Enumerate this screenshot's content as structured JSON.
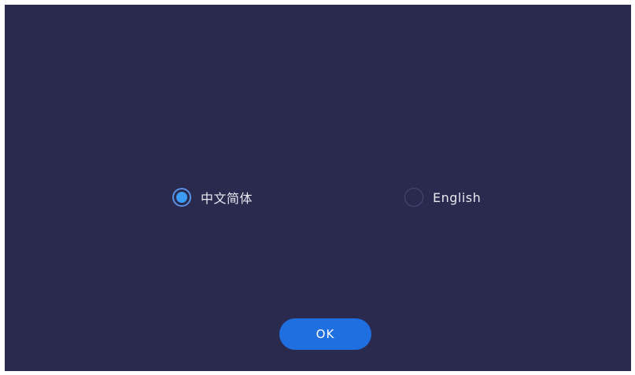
{
  "language_options": [
    {
      "label": "中文简体",
      "selected": true
    },
    {
      "label": "English",
      "selected": false
    }
  ],
  "ok_button": {
    "label": "OK"
  },
  "colors": {
    "background": "#2a2a4e",
    "accent": "#3a9cf5",
    "button": "#1f6fe0"
  }
}
